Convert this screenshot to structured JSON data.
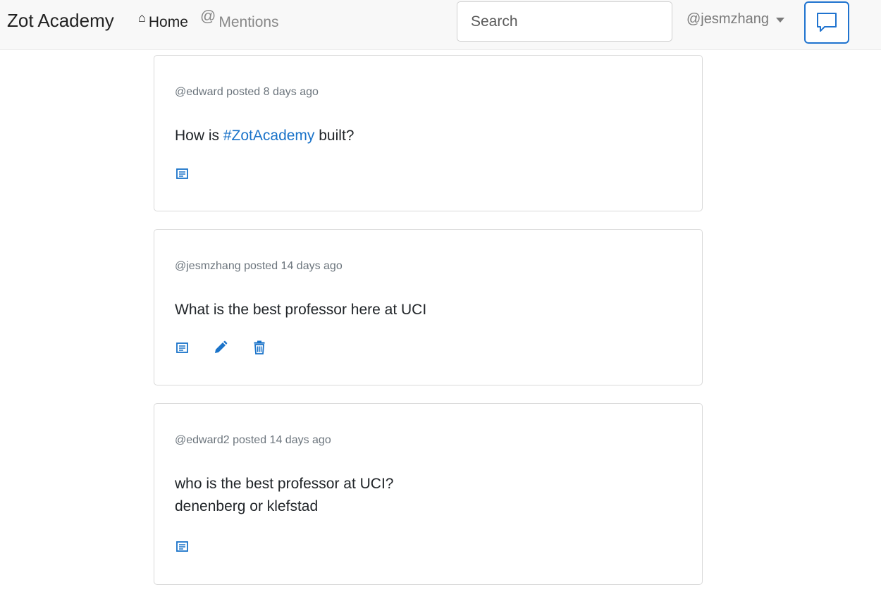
{
  "navbar": {
    "brand": "Zot Academy",
    "home_label": "Home",
    "mentions_label": "Mentions",
    "search_placeholder": "Search",
    "username": "@jesmzhang"
  },
  "icons": {
    "home": "home-icon",
    "mentions": "at-sign-icon",
    "compose": "chat-bubble-icon",
    "comment": "comment-icon",
    "edit": "pencil-icon",
    "delete": "trash-icon"
  },
  "colors": {
    "accent": "#1a73c9",
    "navbar_bg": "#f8f8f8"
  },
  "posts": [
    {
      "meta": "@edward posted 8 days ago",
      "text_before": "How is ",
      "hashtag": "#ZotAcademy",
      "text_after": " built?",
      "actions": [
        "comment"
      ]
    },
    {
      "meta": "@jesmzhang posted 14 days ago",
      "text": "What is the best professor here at UCI",
      "actions": [
        "comment",
        "edit",
        "delete"
      ]
    },
    {
      "meta": "@edward2 posted 14 days ago",
      "line1": "who is the best professor at UCI?",
      "line2": "denenberg or klefstad",
      "actions": [
        "comment"
      ]
    }
  ]
}
